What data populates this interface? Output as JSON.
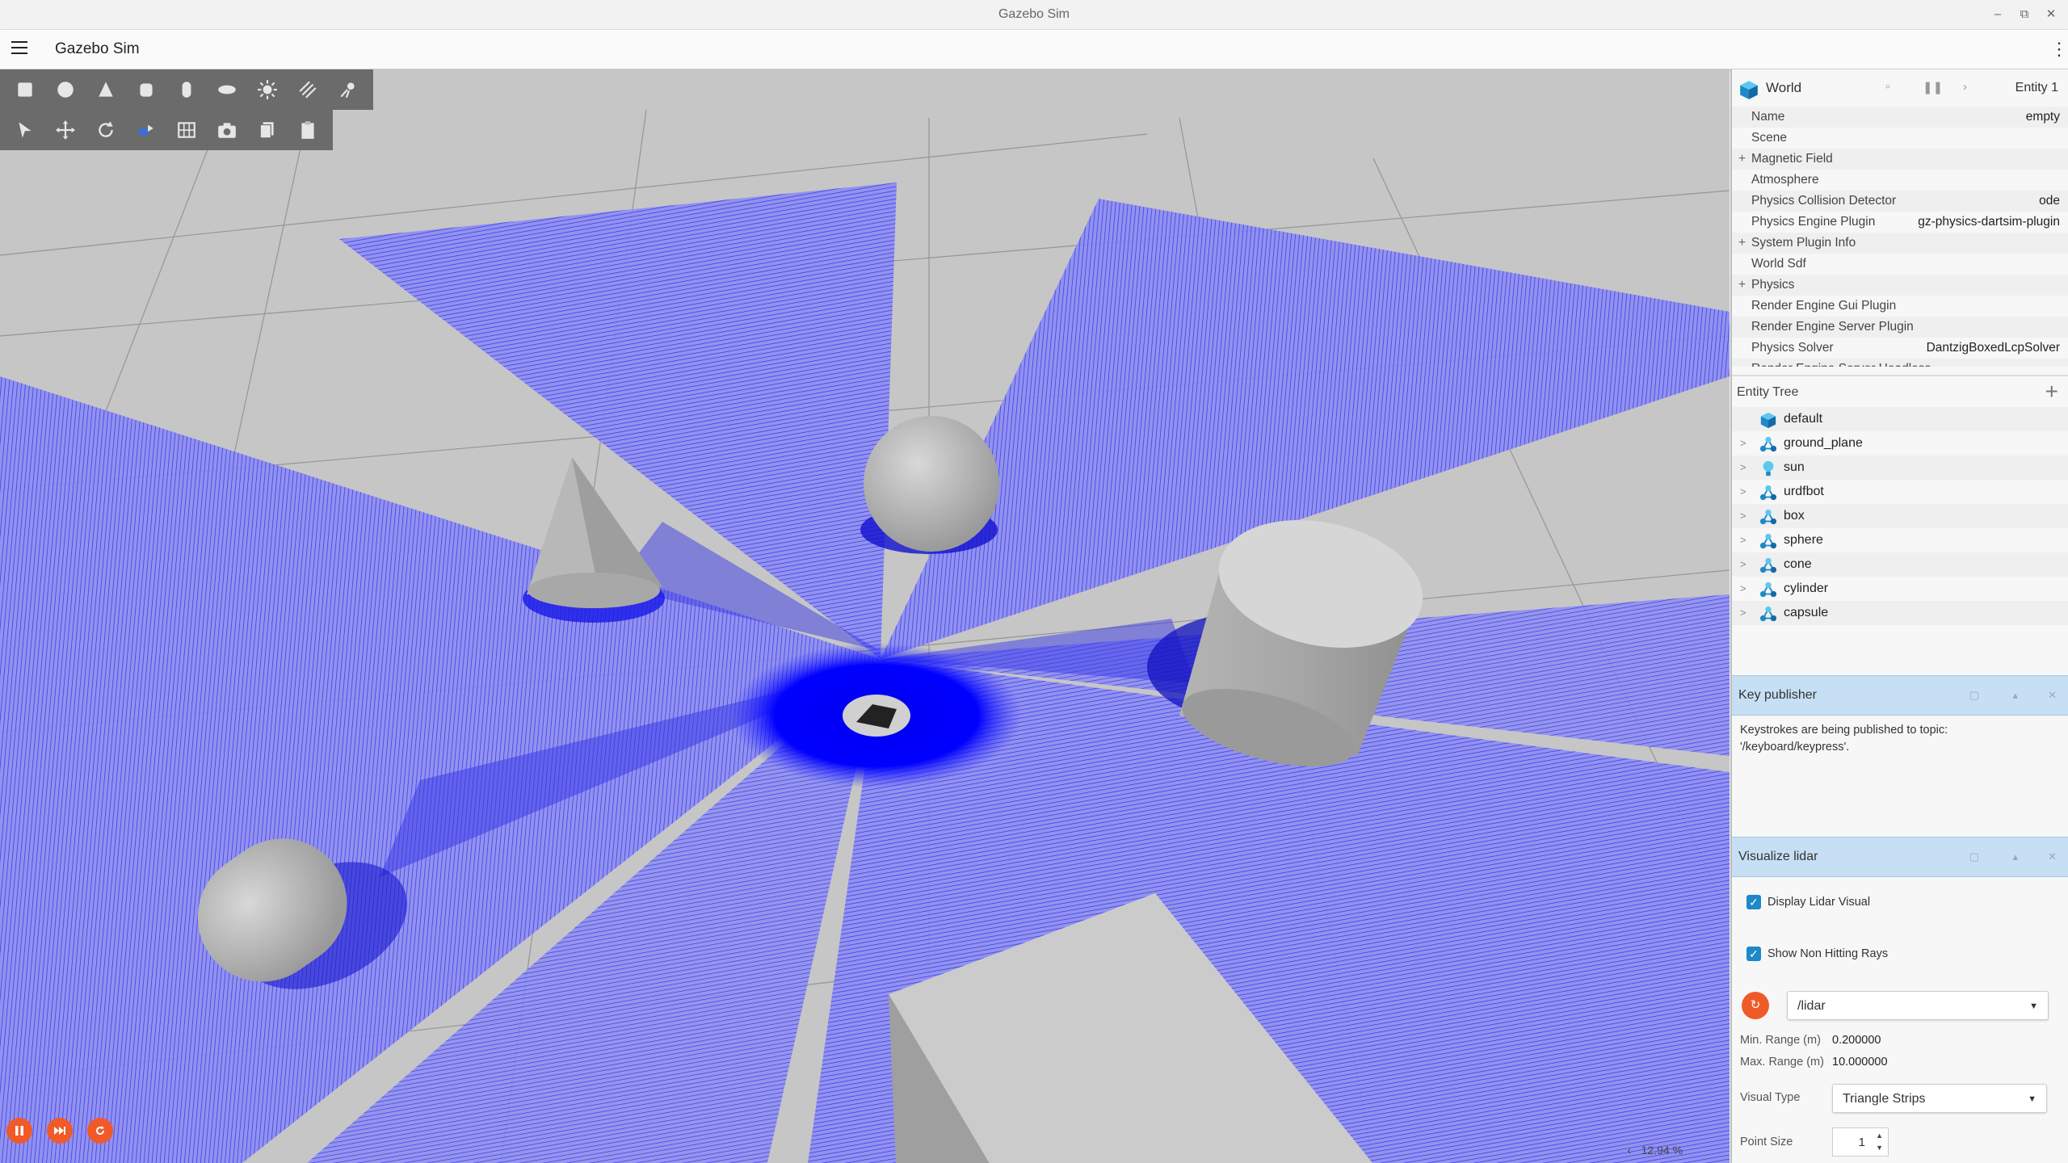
{
  "window": {
    "title": "Gazebo Sim",
    "controls": [
      "–",
      "⧉",
      "✕"
    ]
  },
  "app": {
    "title": "Gazebo Sim"
  },
  "viewport": {
    "shape_tools": [
      "box-icon",
      "sphere-icon",
      "cone-icon",
      "cylinder-icon",
      "capsule-icon",
      "ellipsoid-icon",
      "sun-light-icon",
      "directional-light-icon",
      "spot-light-icon"
    ],
    "transform_tools": [
      "select-icon",
      "translate-icon",
      "rotate-icon",
      "snap-icon",
      "grid-icon",
      "screenshot-icon",
      "copy-icon",
      "paste-icon"
    ],
    "rtf": "12.94 %",
    "rtf_arrow": "‹",
    "lidar_color": "#1a1aff",
    "ground_color": "#c9c9c9",
    "accent": "#f05a28"
  },
  "component_view": {
    "world_label": "World",
    "entity_label": "Entity 1",
    "rows": [
      {
        "plus": "",
        "label": "Name",
        "value": "empty"
      },
      {
        "plus": "",
        "label": "Scene",
        "value": ""
      },
      {
        "plus": "+",
        "label": "Magnetic Field",
        "value": ""
      },
      {
        "plus": "",
        "label": "Atmosphere",
        "value": ""
      },
      {
        "plus": "",
        "label": "Physics Collision Detector",
        "value": "ode"
      },
      {
        "plus": "",
        "label": "Physics Engine Plugin",
        "value": "gz-physics-dartsim-plugin"
      },
      {
        "plus": "+",
        "label": "System Plugin Info",
        "value": ""
      },
      {
        "plus": "",
        "label": "World Sdf",
        "value": ""
      },
      {
        "plus": "+",
        "label": "Physics",
        "value": ""
      },
      {
        "plus": "",
        "label": "Render Engine Gui Plugin",
        "value": ""
      },
      {
        "plus": "",
        "label": "Render Engine Server Plugin",
        "value": ""
      },
      {
        "plus": "",
        "label": "Physics Solver",
        "value": "DantzigBoxedLcpSolver"
      },
      {
        "plus": "",
        "label": "Render Engine Server Headless",
        "value": ""
      }
    ]
  },
  "entity_tree": {
    "title": "Entity Tree",
    "add": "+",
    "items": [
      {
        "label": "default",
        "icon": "world-icon",
        "expandable": false
      },
      {
        "label": "ground_plane",
        "icon": "model-icon",
        "expandable": true
      },
      {
        "label": "sun",
        "icon": "light-icon",
        "expandable": true
      },
      {
        "label": "urdfbot",
        "icon": "model-icon",
        "expandable": true
      },
      {
        "label": "box",
        "icon": "model-icon",
        "expandable": true
      },
      {
        "label": "sphere",
        "icon": "model-icon",
        "expandable": true
      },
      {
        "label": "cone",
        "icon": "model-icon",
        "expandable": true
      },
      {
        "label": "cylinder",
        "icon": "model-icon",
        "expandable": true
      },
      {
        "label": "capsule",
        "icon": "model-icon",
        "expandable": true
      }
    ]
  },
  "key_publisher": {
    "title": "Key publisher",
    "body_line1": "Keystrokes are being published to topic:",
    "body_line2": "'/keyboard/keypress'."
  },
  "visualize_lidar": {
    "title": "Visualize lidar",
    "display_visual_label": "Display Lidar Visual",
    "display_visual_checked": true,
    "non_hitting_label": "Show Non Hitting Rays",
    "non_hitting_checked": true,
    "topic": "/lidar",
    "min_range_label": "Min. Range (m)",
    "min_range": "0.200000",
    "max_range_label": "Max. Range (m)",
    "max_range": "10.000000",
    "visual_type_label": "Visual Type",
    "visual_type": "Triangle Strips",
    "point_size_label": "Point Size",
    "point_size": "1"
  }
}
